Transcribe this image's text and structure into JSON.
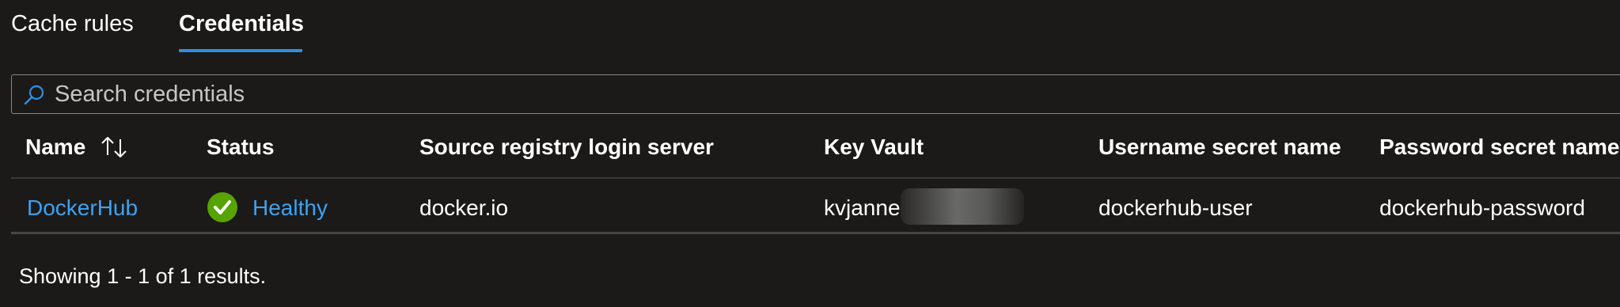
{
  "tabs": [
    {
      "label": "Cache rules",
      "selected": false
    },
    {
      "label": "Credentials",
      "selected": true
    }
  ],
  "search": {
    "placeholder": "Search credentials",
    "value": ""
  },
  "table": {
    "headers": [
      "Name",
      "Status",
      "Source registry login server",
      "Key Vault",
      "Username secret name",
      "Password secret name"
    ],
    "rows": [
      {
        "name": "DockerHub",
        "status": "Healthy",
        "source_registry_login_server": "docker.io",
        "key_vault": "kvjanne",
        "username_secret_name": "dockerhub-user",
        "password_secret_name": "dockerhub-password"
      }
    ]
  },
  "footer": {
    "results_text": "Showing 1 - 1 of 1 results."
  },
  "colors": {
    "accent": "#2f8fe0",
    "link": "#3ea2f2",
    "success": "#57a300",
    "background": "#1b1a19"
  },
  "icons": {
    "search": "search-icon",
    "sort": "sort-arrows-icon",
    "status": "check-circle-icon"
  }
}
